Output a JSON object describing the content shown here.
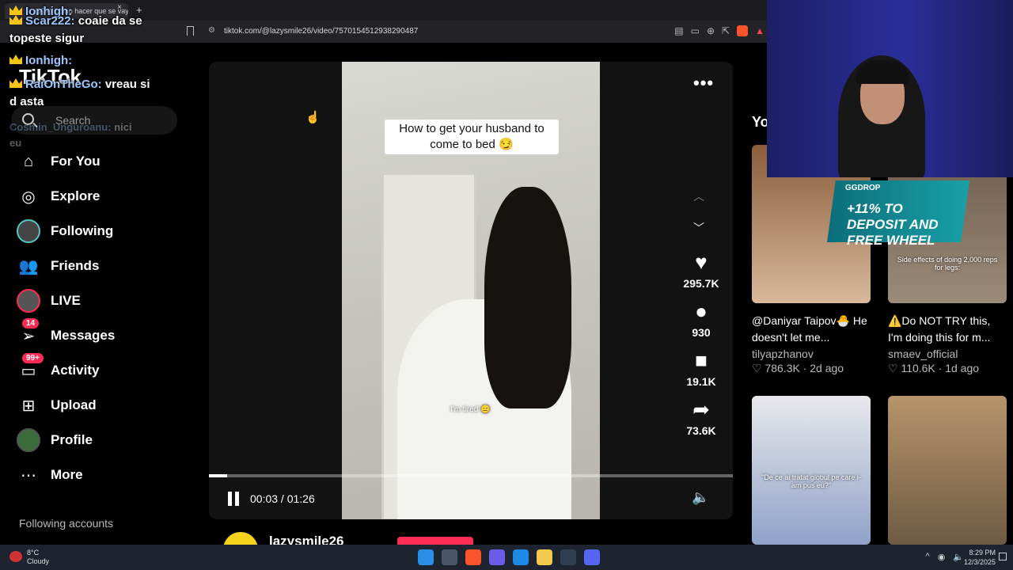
{
  "browser": {
    "tab_title": "(99+) Cómo hacer que se vay",
    "tab_close": "×",
    "new_tab": "+",
    "url": "tiktok.com/@lazysmile26/video/7570154512938290487",
    "toolbar_icons": [
      "reader-icon",
      "cast-icon",
      "zoom-icon",
      "share-icon",
      "brave-shield-icon",
      "brave-rewards-icon"
    ]
  },
  "stream_chat": [
    {
      "user": "Ionhigh:",
      "message": ""
    },
    {
      "user": "Scar222:",
      "message": " coaie da se"
    },
    {
      "user": "",
      "message": "topeste sigur"
    },
    {
      "user": "Ionhigh:",
      "message": ""
    },
    {
      "user": "RaiOnTheGo:",
      "message": " vreau si"
    },
    {
      "user": "",
      "message": "d asta"
    },
    {
      "user": "Cosmin_Unguroanu:",
      "message": " nici"
    },
    {
      "user": "",
      "message": "eu"
    }
  ],
  "sidebar": {
    "logo": "TikTok",
    "search_placeholder": "Search",
    "items": [
      {
        "label": "For You",
        "icon": "home-icon"
      },
      {
        "label": "Explore",
        "icon": "compass-icon"
      },
      {
        "label": "Following",
        "icon": "following-avatar"
      },
      {
        "label": "Friends",
        "icon": "friends-icon"
      },
      {
        "label": "LIVE",
        "icon": "live-avatar"
      },
      {
        "label": "Messages",
        "icon": "messages-icon",
        "badge": "14"
      },
      {
        "label": "Activity",
        "icon": "activity-icon",
        "badge": "99+"
      },
      {
        "label": "Upload",
        "icon": "upload-icon"
      },
      {
        "label": "Profile",
        "icon": "profile-avatar"
      },
      {
        "label": "More",
        "icon": "more-icon"
      }
    ],
    "following_accounts_label": "Following accounts"
  },
  "video": {
    "caption": "How to get your husband to come to bed 😏",
    "subtitle": "I'm tired 😑",
    "time_display": "00:03 / 01:26",
    "progress_fraction": 0.035,
    "likes": "295.7K",
    "comments": "930",
    "saves": "19.1K",
    "shares": "73.6K",
    "author": "lazysmile26"
  },
  "right_column": {
    "title": "Yo",
    "cards": [
      {
        "title": "@Daniyar Taipov🐣 He doesn't let me...",
        "author": "tilyapzhanov",
        "meta": "♡ 786.3K · 2d ago",
        "thumb_text": ""
      },
      {
        "title": "⚠️Do NOT TRY this, I'm doing this for m...",
        "author": "smaev_official",
        "meta": "♡ 110.6K · 1d ago",
        "thumb_text": "Side effects of doing 2,000 reps for legs:"
      },
      {
        "title": "",
        "author": "",
        "meta": "",
        "thumb_text": "\"De ce ai tratat globul pe care i-am pus eu?\""
      },
      {
        "title": "",
        "author": "",
        "meta": "",
        "thumb_text": ""
      }
    ]
  },
  "promo": {
    "tag": "GGDROP",
    "text": "+11% TO DEPOSIT AND FREE WHEEL"
  },
  "taskbar": {
    "temp": "8°C",
    "condition": "Cloudy",
    "time": "8:29 PM",
    "date": "12/3/2025"
  },
  "colors": {
    "accent": "#fe2c55",
    "background": "#000000",
    "following_ring": "#57c7c3"
  }
}
